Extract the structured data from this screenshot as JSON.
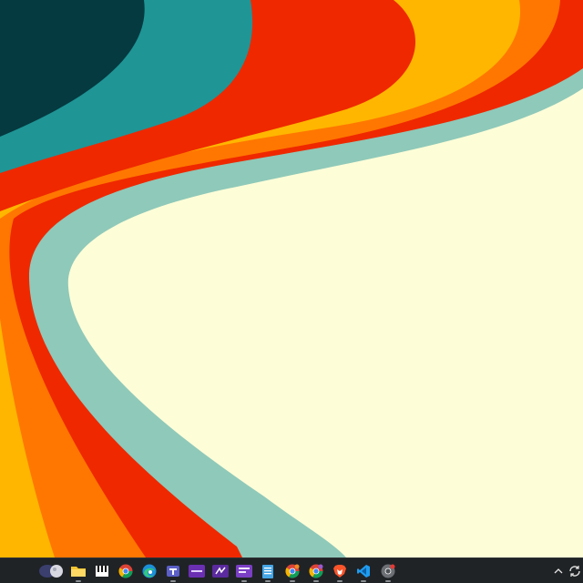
{
  "desktop": {
    "wallpaper": "retro-wave-curves"
  },
  "colors": {
    "dark_teal": "#053a40",
    "teal": "#1f9596",
    "red": "#ef2800",
    "amber": "#ffb600",
    "orange": "#ff7700",
    "mint": "#8fc9b9",
    "cream": "#fdfdd8",
    "taskbar": "#202326"
  },
  "taskbar": {
    "apps": [
      {
        "name": "cortana-search",
        "icon": "moon-swirl-icon"
      },
      {
        "name": "file-explorer",
        "icon": "folder-icon"
      },
      {
        "name": "piano-app",
        "icon": "piano-keys-icon"
      },
      {
        "name": "chrome",
        "icon": "chrome-icon"
      },
      {
        "name": "edge",
        "icon": "edge-icon"
      },
      {
        "name": "teams-like-app",
        "icon": "purple-app-icon"
      },
      {
        "name": "purple-app-2",
        "icon": "purple-tile-icon"
      },
      {
        "name": "purple-app-3",
        "icon": "purple-tile-icon"
      },
      {
        "name": "purple-app-4",
        "icon": "purple-tile-icon"
      },
      {
        "name": "notepad",
        "icon": "notepad-icon"
      },
      {
        "name": "chrome-profile-2",
        "icon": "chrome-icon"
      },
      {
        "name": "chrome-profile-3",
        "icon": "chrome-icon"
      },
      {
        "name": "brave",
        "icon": "brave-lion-icon"
      },
      {
        "name": "vscode",
        "icon": "vscode-icon"
      },
      {
        "name": "chrome-profile-4",
        "icon": "chrome-icon"
      }
    ],
    "tray": {
      "overflow_icon": "chevron-up-icon",
      "update_icon": "sync-icon"
    }
  }
}
